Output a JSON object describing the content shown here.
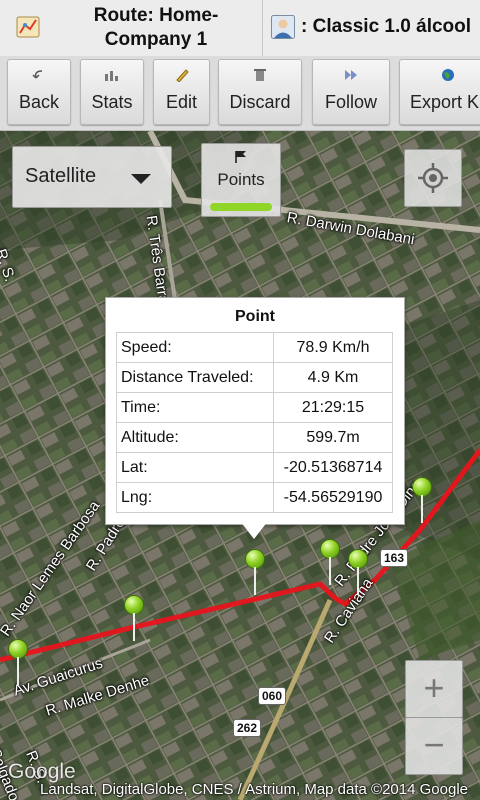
{
  "header": {
    "route_title": "Route: Home-Company 1",
    "car_name": "Classic 1.0 álcool"
  },
  "toolbar": {
    "back": "Back",
    "stats": "Stats",
    "edit": "Edit",
    "discard": "Discard",
    "follow": "Follow",
    "export": "Export KML"
  },
  "map_controls": {
    "map_type": "Satellite",
    "points": "Points",
    "zoom_in": "+",
    "zoom_out": "−"
  },
  "popup": {
    "title": "Point",
    "rows": [
      {
        "label": "Speed:",
        "value": "78.9 Km/h"
      },
      {
        "label": "Distance Traveled:",
        "value": "4.9 Km"
      },
      {
        "label": "Time:",
        "value": "21:29:15"
      },
      {
        "label": "Altitude:",
        "value": "599.7m"
      },
      {
        "label": "Lat:",
        "value": "-20.51368714"
      },
      {
        "label": "Lng:",
        "value": "-54.56529190"
      }
    ]
  },
  "streets": {
    "darwin": "R. Darwin Dolabani",
    "tres_barras": "R. Três Barras",
    "naor": "R. Naor Lemes Barbosa",
    "padre": "R. Padre",
    "padre_jose": "R. Padre José Dino",
    "caviana": "R. Caviana",
    "guaicurus": "Av. Guaicurus",
    "malke": "R. Malke Denhe",
    "s_left": "R. S.",
    "salgado": "Salgado",
    "rs": "R. S."
  },
  "road_shields": {
    "s163": "163",
    "s060": "060",
    "s262": "262"
  },
  "attribution": "Landsat, DigitalGlobe, CNES / Astrium, Map data ©2014 Google",
  "google_logo": "Google",
  "colors": {
    "route": "#e8141c",
    "pin": "#8ed021",
    "points_bar": "#8fd629"
  }
}
